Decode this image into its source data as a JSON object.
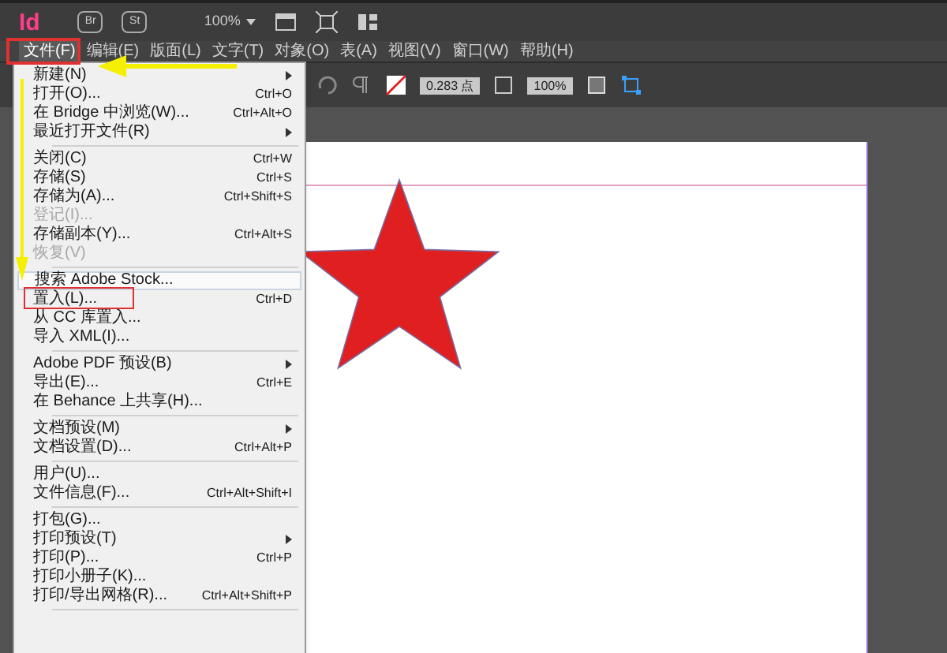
{
  "app_bar": {
    "logo": "Id",
    "buttons": [
      "Br",
      "St"
    ],
    "zoom": "100%"
  },
  "menu_bar": [
    {
      "label": "文件(F)",
      "selected": true
    },
    {
      "label": "编辑(E)",
      "selected": false
    },
    {
      "label": "版面(L)",
      "selected": false
    },
    {
      "label": "文字(T)",
      "selected": false
    },
    {
      "label": "对象(O)",
      "selected": false
    },
    {
      "label": "表(A)",
      "selected": false
    },
    {
      "label": "视图(V)",
      "selected": false
    },
    {
      "label": "窗口(W)",
      "selected": false
    },
    {
      "label": "帮助(H)",
      "selected": false
    }
  ],
  "control_bar": {
    "stroke_weight": "0.283 点",
    "opacity": "100%"
  },
  "file_menu": [
    [
      {
        "label": "新建(N)",
        "submenu": true,
        "disabled": false,
        "selected": false
      },
      {
        "label": "打开(O)...",
        "shortcut": "Ctrl+O",
        "submenu": false,
        "disabled": false,
        "selected": false
      },
      {
        "label": "在 Bridge 中浏览(W)...",
        "shortcut": "Ctrl+Alt+O",
        "submenu": false,
        "disabled": false,
        "selected": false
      },
      {
        "label": "最近打开文件(R)",
        "submenu": true,
        "disabled": false,
        "selected": false
      }
    ],
    [
      {
        "label": "关闭(C)",
        "shortcut": "Ctrl+W",
        "submenu": false,
        "disabled": false,
        "selected": false
      },
      {
        "label": "存储(S)",
        "shortcut": "Ctrl+S",
        "submenu": false,
        "disabled": false,
        "selected": false
      },
      {
        "label": "存储为(A)...",
        "shortcut": "Ctrl+Shift+S",
        "submenu": false,
        "disabled": false,
        "selected": false
      },
      {
        "label": "登记(I)...",
        "submenu": false,
        "disabled": true,
        "selected": false
      },
      {
        "label": "存储副本(Y)...",
        "shortcut": "Ctrl+Alt+S",
        "submenu": false,
        "disabled": false,
        "selected": false
      },
      {
        "label": "恢复(V)",
        "submenu": false,
        "disabled": true,
        "selected": false
      }
    ],
    [
      {
        "label": "搜索 Adobe Stock...",
        "submenu": false,
        "disabled": false,
        "selected": true
      },
      {
        "label": "置入(L)...",
        "shortcut": "Ctrl+D",
        "submenu": false,
        "disabled": false,
        "selected": false
      },
      {
        "label": "从 CC 库置入...",
        "submenu": false,
        "disabled": false,
        "selected": false
      },
      {
        "label": "导入 XML(I)...",
        "submenu": false,
        "disabled": false,
        "selected": false
      }
    ],
    [
      {
        "label": "Adobe PDF 预设(B)",
        "submenu": true,
        "disabled": false,
        "selected": false
      },
      {
        "label": "导出(E)...",
        "shortcut": "Ctrl+E",
        "submenu": false,
        "disabled": false,
        "selected": false
      },
      {
        "label": "在 Behance 上共享(H)...",
        "submenu": false,
        "disabled": false,
        "selected": false
      }
    ],
    [
      {
        "label": "文档预设(M)",
        "submenu": true,
        "disabled": false,
        "selected": false
      },
      {
        "label": "文档设置(D)...",
        "shortcut": "Ctrl+Alt+P",
        "submenu": false,
        "disabled": false,
        "selected": false
      }
    ],
    [
      {
        "label": "用户(U)...",
        "submenu": false,
        "disabled": false,
        "selected": false
      },
      {
        "label": "文件信息(F)...",
        "shortcut": "Ctrl+Alt+Shift+I",
        "submenu": false,
        "disabled": false,
        "selected": false
      }
    ],
    [
      {
        "label": "打包(G)...",
        "submenu": false,
        "disabled": false,
        "selected": false
      },
      {
        "label": "打印预设(T)",
        "submenu": true,
        "disabled": false,
        "selected": false
      },
      {
        "label": "打印(P)...",
        "shortcut": "Ctrl+P",
        "submenu": false,
        "disabled": false,
        "selected": false
      },
      {
        "label": "打印小册子(K)...",
        "submenu": false,
        "disabled": false,
        "selected": false
      },
      {
        "label": "打印/导出网格(R)...",
        "shortcut": "Ctrl+Alt+Shift+P",
        "submenu": false,
        "disabled": false,
        "selected": false
      }
    ]
  ]
}
